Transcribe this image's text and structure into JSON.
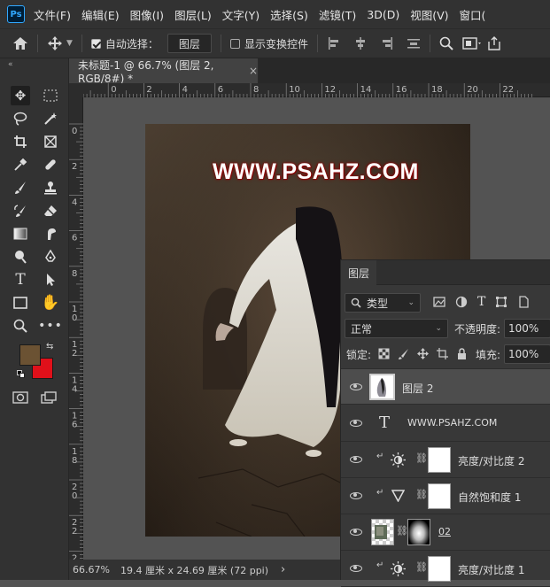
{
  "menubar": {
    "logo": "Ps",
    "items": [
      "文件(F)",
      "编辑(E)",
      "图像(I)",
      "图层(L)",
      "文字(Y)",
      "选择(S)",
      "滤镜(T)",
      "3D(D)",
      "视图(V)",
      "窗口("
    ]
  },
  "options": {
    "auto_select_label": "自动选择：",
    "auto_select_value": "图层",
    "show_transform_label": "显示变换控件"
  },
  "document": {
    "tab_title": "未标题-1 @ 66.7% (图层 2, RGB/8#) *",
    "watermark": "WWW.PSAHZ.COM"
  },
  "rulers": {
    "h_ticks": [
      "2",
      "0",
      "2",
      "4",
      "6",
      "8",
      "10",
      "12",
      "14",
      "16",
      "18",
      "20",
      "22"
    ],
    "v_ticks": [
      "0",
      "2",
      "4",
      "6",
      "8",
      "1\n0",
      "1\n2",
      "1\n4",
      "1\n6",
      "1\n8",
      "2\n0",
      "2\n2",
      "2\n4"
    ]
  },
  "status": {
    "zoom": "66.67%",
    "doc_size": "19.4 厘米 x 24.69 厘米 (72 ppi)",
    "arrow": "›"
  },
  "colors": {
    "foreground": "#6b5233",
    "background": "#e0101a"
  },
  "layers_panel": {
    "title": "图层",
    "filter_kind": "类型",
    "blend_mode": "正常",
    "opacity_label": "不透明度:",
    "opacity_value": "100%",
    "lock_label": "锁定:",
    "fill_label": "填充:",
    "fill_value": "100%",
    "layers": [
      {
        "name": "图层 2",
        "type": "pixel",
        "selected": true
      },
      {
        "name": "WWW.PSAHZ.COM",
        "type": "text",
        "selected": false
      },
      {
        "name": "亮度/对比度 2",
        "type": "adjust-brightness",
        "selected": false
      },
      {
        "name": "自然饱和度 1",
        "type": "adjust-vibrance",
        "selected": false
      },
      {
        "name": "02",
        "type": "masked-image",
        "selected": false
      },
      {
        "name": "亮度/对比度 1",
        "type": "adjust-brightness",
        "selected": false
      }
    ]
  }
}
